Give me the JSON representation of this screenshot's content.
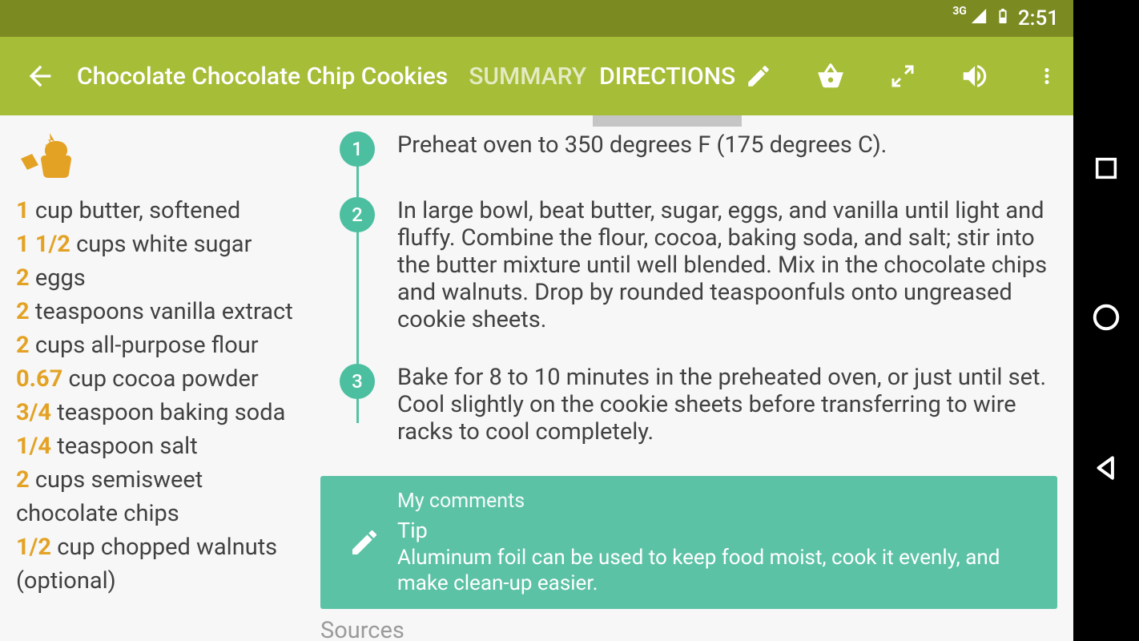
{
  "status": {
    "network": "3G",
    "time": "2:51"
  },
  "header": {
    "title": "Chocolate Chocolate Chip Cookies",
    "tabs": {
      "summary": "SUMMARY",
      "directions": "DIRECTIONS"
    }
  },
  "ingredients": [
    {
      "qty": "1",
      "rest": " cup butter, softened"
    },
    {
      "qty": "1 1/2",
      "rest": " cups white sugar"
    },
    {
      "qty": "2",
      "rest": " eggs"
    },
    {
      "qty": "2",
      "rest": " teaspoons vanilla extract"
    },
    {
      "qty": "2",
      "rest": " cups all-purpose flour"
    },
    {
      "qty": "0.67",
      "rest": " cup cocoa powder"
    },
    {
      "qty": "3/4",
      "rest": " teaspoon baking soda"
    },
    {
      "qty": "1/4",
      "rest": " teaspoon salt"
    },
    {
      "qty": "2",
      "rest": " cups semisweet chocolate chips"
    },
    {
      "qty": "1/2",
      "rest": " cup chopped walnuts (optional)"
    }
  ],
  "steps": [
    "Preheat oven to 350 degrees F (175 degrees C).",
    "In large bowl, beat butter, sugar, eggs, and vanilla until light and fluffy. Combine the flour, cocoa, baking soda, and salt; stir into the butter mixture until well blended. Mix in the chocolate chips and walnuts. Drop by rounded teaspoonfuls onto ungreased cookie sheets.",
    "Bake for 8 to 10 minutes in the preheated oven, or just until set. Cool slightly on the cookie sheets before transferring to wire racks to cool completely."
  ],
  "comments": {
    "heading": "My comments",
    "subtitle": "Tip",
    "body": "Aluminum foil can be used to keep food moist, cook it evenly, and make clean-up easier."
  },
  "sources_label": "Sources"
}
